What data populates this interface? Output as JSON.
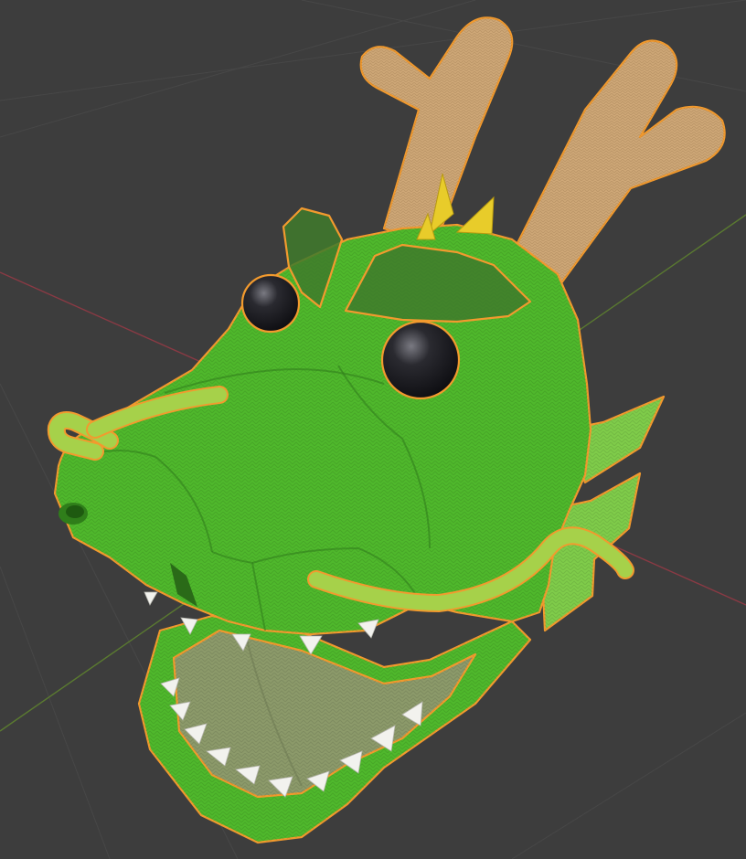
{
  "viewport": {
    "background_color": "#3d3d3d",
    "grid_line_color": "#474747",
    "x_axis_color": "#8a3a44",
    "y_axis_color": "#5a7a30"
  },
  "object": {
    "type": "dragon head mesh",
    "selected": true,
    "selection_outline_color": "#f29a2e",
    "body_color": "#4fb82c",
    "antler_color": "#cfa878",
    "eye_color": "#1c1c20",
    "fin_color": "#7fcc4a",
    "mouth_color": "#8c9a6a",
    "teeth_color": "#f2f2ee",
    "brow_patch_color": "#3f7a2c",
    "spike_color": "#e8cc2a"
  }
}
